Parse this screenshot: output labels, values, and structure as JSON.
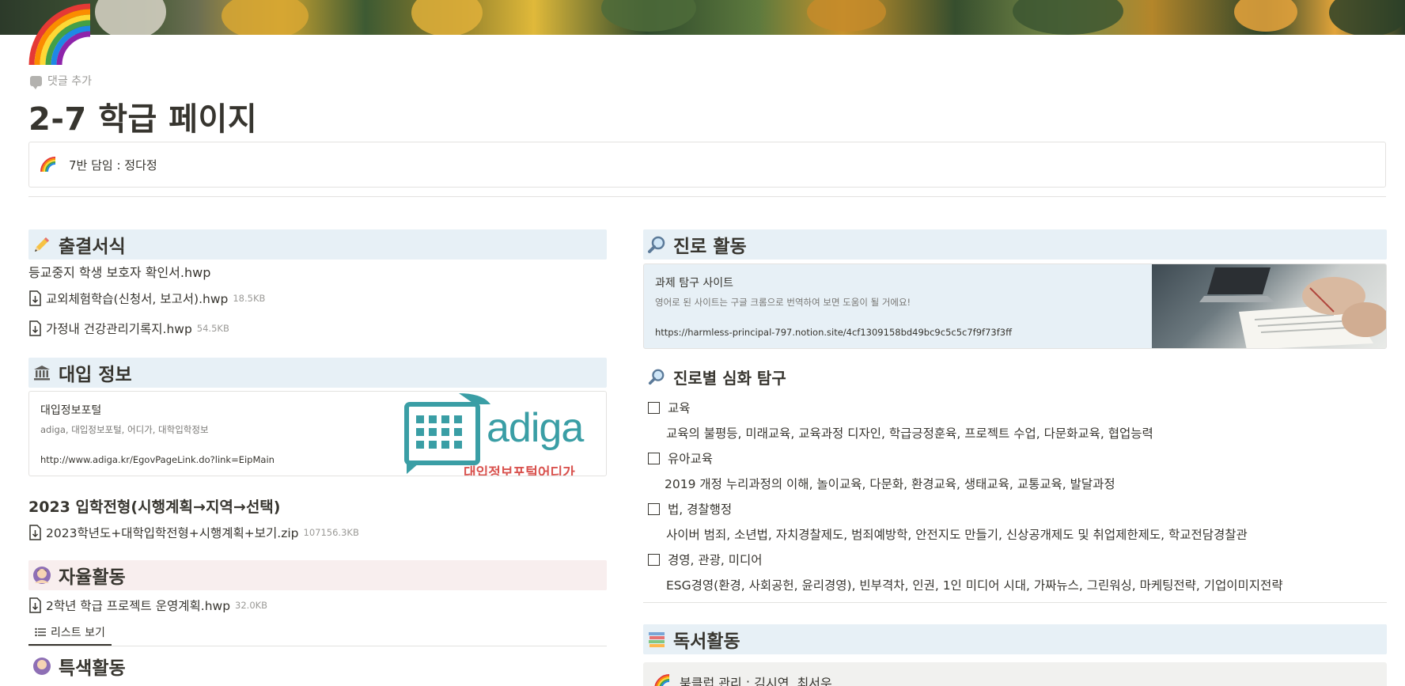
{
  "page": {
    "comment_label": "댓글 추가",
    "title": "2-7 학급 페이지",
    "callout_text": "7반 담임 : 정다정"
  },
  "left": {
    "attendance": {
      "heading": "출결서식",
      "plain_item": "등교중지 학생 보호자 확인서.hwp",
      "files": [
        {
          "name": "교외체험학습(신청서, 보고서).hwp",
          "size": "18.5KB"
        },
        {
          "name": "가정내 건강관리기록지.hwp",
          "size": "54.5KB"
        }
      ]
    },
    "admissions": {
      "heading": "대입 정보",
      "bookmark": {
        "title": "대입정보포털",
        "desc": "adiga, 대입정보포털, 어디가, 대학입학정보",
        "url": "http://www.adiga.kr/EgovPageLink.do?link=EipMain",
        "logo_text": "adiga",
        "logo_sub": "대입정보포털어디가"
      },
      "subheading": "2023 입학전형(시행계획→지역→선택)",
      "file": {
        "name": "2023학년도+대학입학전형+시행계획+보기.zip",
        "size": "107156.3KB"
      }
    },
    "autonomous": {
      "heading": "자율활동",
      "file": {
        "name": "2학년 학급 프로젝트 운영계획.hwp",
        "size": "32.0KB"
      },
      "tab_label": "리스트 보기"
    },
    "special": {
      "heading": "특색활동"
    }
  },
  "right": {
    "career": {
      "heading": "진로 활동",
      "bookmark": {
        "title": "과제 탐구 사이트",
        "desc": "영어로 된 사이트는 구글 크롬으로 번역하여 보면 도움이 될 거에요!",
        "url": "https://harmless-principal-797.notion.site/4cf1309158bd49bc9c5c5c7f9f73f3ff"
      }
    },
    "deep_inquiry": {
      "heading": "진로별 심화 탐구",
      "items": [
        {
          "label": "교육",
          "desc": "교육의 불평등, 미래교육, 교육과정 디자인, 학급긍정훈육, 프로젝트 수업, 다문화교육, 협업능력"
        },
        {
          "label": "유아교육",
          "desc": "2019 개정 누리과정의 이해, 놀이교육, 다문화, 환경교육, 생태교육, 교통교육, 발달과정"
        },
        {
          "label": "법, 경찰행정",
          "desc": "사이버 범죄, 소년법, 자치경찰제도, 범죄예방학, 안전지도 만들기, 신상공개제도 및 취업제한제도, 학교전담경찰관"
        },
        {
          "label": "경영, 관광, 미디어",
          "desc": "ESG경영(환경, 사회공헌, 윤리경영), 빈부격차, 인권, 1인 미디어 시대, 가짜뉴스, 그린워싱, 마케팅전략, 기업이미지전략"
        }
      ]
    },
    "reading": {
      "heading": "독서활동",
      "callout_text": "북클럽 관리 : 김시연, 최서우"
    }
  },
  "colors": {
    "heading_blue": "#e7f0f6",
    "heading_red": "#f8eeee",
    "heading_gray": "#f1f1ef",
    "text": "#37352f",
    "muted": "#9b9a97"
  }
}
